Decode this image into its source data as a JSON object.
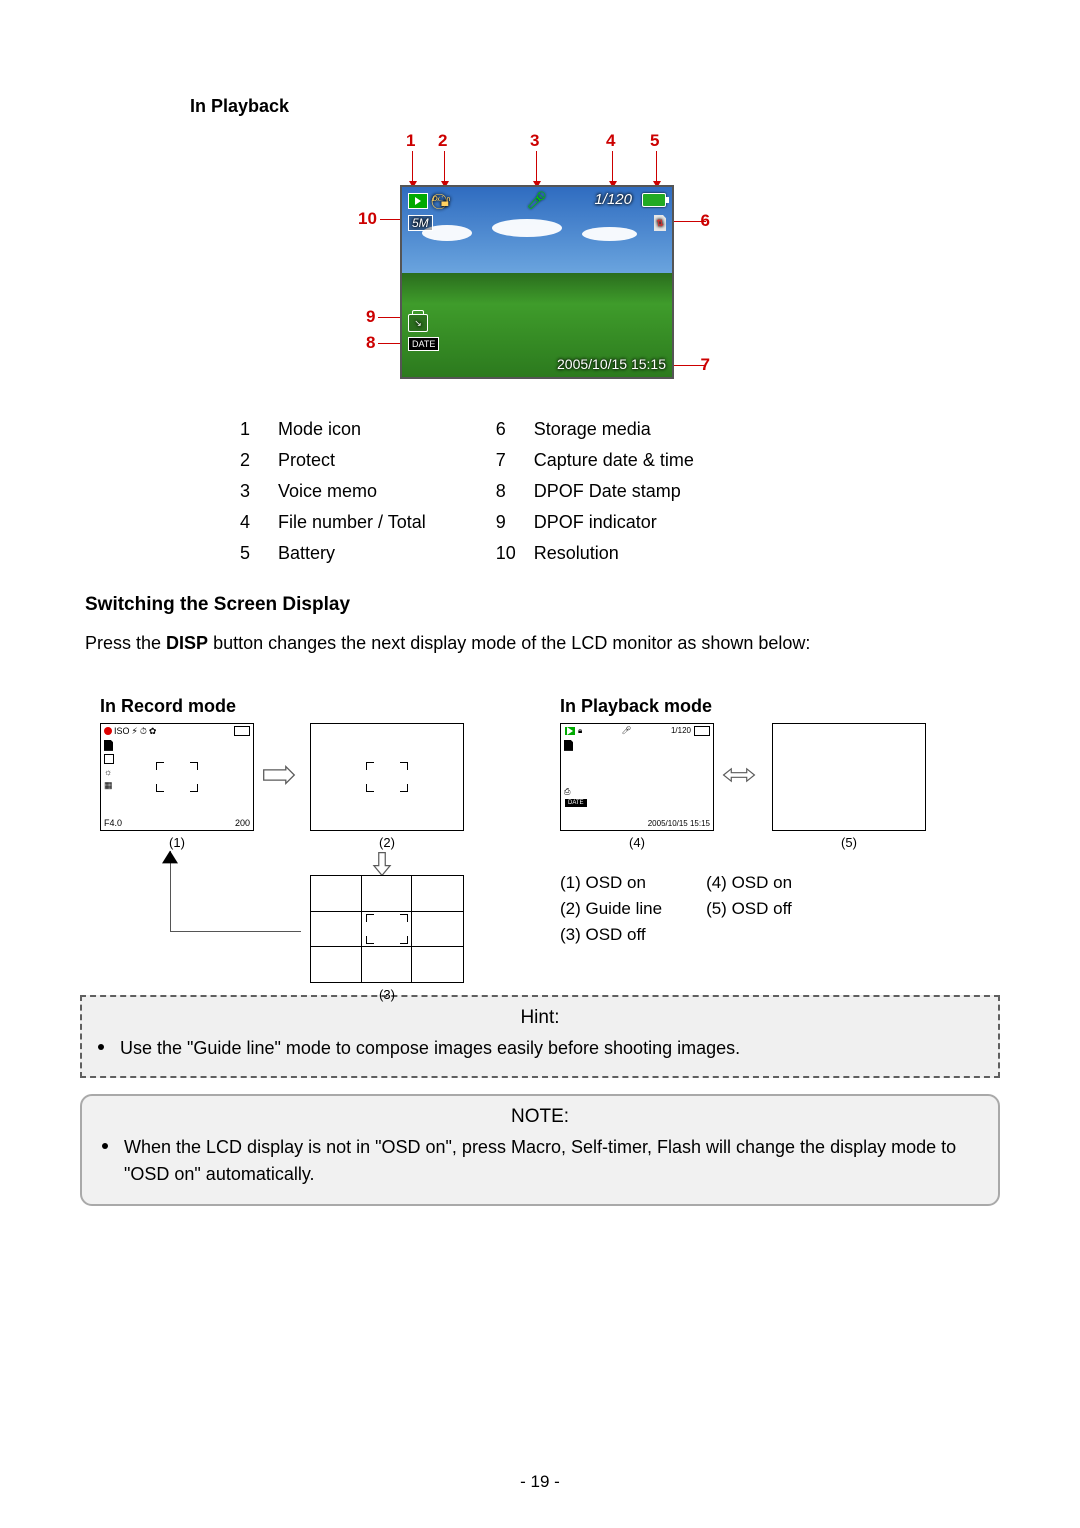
{
  "headings": {
    "in_playback": "In Playback",
    "switching": "Switching the Screen Display",
    "in_record_mode": "In Record mode",
    "in_playback_mode": "In Playback mode"
  },
  "body": {
    "switch_text_pre": "Press the ",
    "switch_text_bold": "DISP",
    "switch_text_post": " button changes the next display mode of the LCD monitor as shown below:"
  },
  "playback_lcd": {
    "file_counter": "1/120",
    "resolution_badge": "5M",
    "date_label": "DATE",
    "datetime": "2005/10/15  15:15"
  },
  "callouts_top": [
    "1",
    "2",
    "3",
    "4",
    "5"
  ],
  "callouts_side": {
    "r6": "6",
    "r7": "7",
    "l8": "8",
    "l9": "9",
    "l10": "10"
  },
  "legend_left": [
    {
      "n": "1",
      "t": "Mode icon"
    },
    {
      "n": "2",
      "t": "Protect"
    },
    {
      "n": "3",
      "t": "Voice memo"
    },
    {
      "n": "4",
      "t": "File number / Total"
    },
    {
      "n": "5",
      "t": "Battery"
    }
  ],
  "legend_right": [
    {
      "n": "6",
      "t": "Storage media"
    },
    {
      "n": "7",
      "t": "Capture date & time"
    },
    {
      "n": "8",
      "t": "DPOF Date stamp"
    },
    {
      "n": "9",
      "t": "DPOF indicator"
    },
    {
      "n": "10",
      "t": "Resolution"
    }
  ],
  "record_mode": {
    "captions": {
      "c1": "(1)",
      "c2": "(2)",
      "c3": "(3)"
    },
    "mini_osd_labels": {
      "top_left_iso": "ISO",
      "bottom_left": "F4.0",
      "bottom_right": "200"
    }
  },
  "playback_mode": {
    "captions": {
      "c4": "(4)",
      "c5": "(5)"
    },
    "mini_osd": {
      "counter": "1/120",
      "datetime": "2005/10/15 15:15"
    }
  },
  "playback_osd_legend": {
    "col1": [
      "(1) OSD on",
      "(2) Guide line",
      "(3) OSD off"
    ],
    "col2": [
      "(4) OSD on",
      "(5) OSD off"
    ]
  },
  "hint": {
    "title": "Hint:",
    "text": "Use the \"Guide line\" mode to compose images easily before shooting images."
  },
  "note": {
    "title": "NOTE:",
    "text": "When the LCD display is not in \"OSD on\", press Macro, Self-timer, Flash will change the display mode to \"OSD on\" automatically."
  },
  "page_number": "- 19 -"
}
